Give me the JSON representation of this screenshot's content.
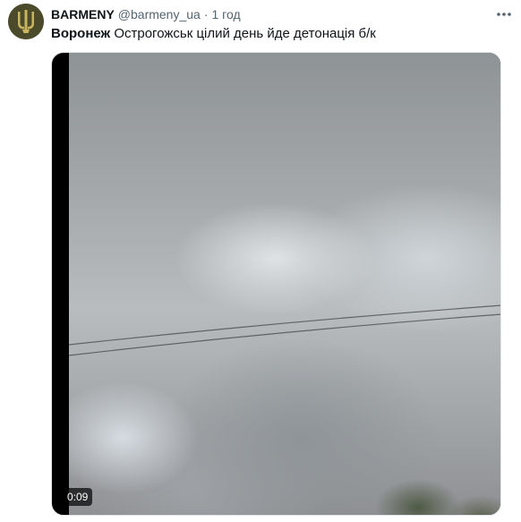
{
  "tweet": {
    "author_name": "BARMENY",
    "author_handle": "@barmeny_ua",
    "separator": "·",
    "timestamp": "1 год",
    "text_bold": "Воронеж",
    "text_rest": " Острогожськ цілий день йде детонація б/к",
    "media": {
      "duration": "0:09"
    }
  },
  "icons": {
    "avatar": "trident-logo",
    "more": "more-horizontal-icon"
  },
  "colors": {
    "avatar_bg": "#4b4b2c",
    "text": "#0f1419",
    "secondary": "#536471"
  }
}
